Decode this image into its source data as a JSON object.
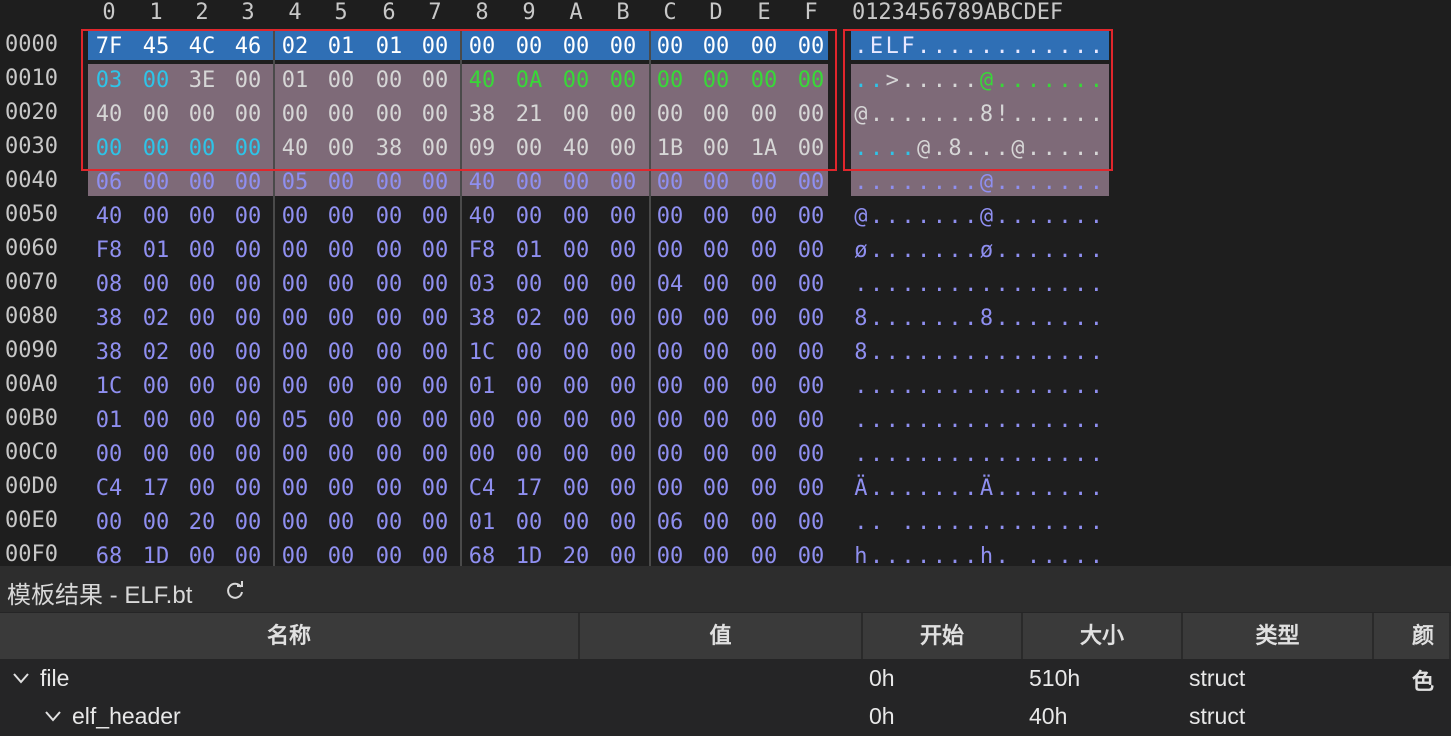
{
  "hex_header": {
    "columns": [
      "0",
      "1",
      "2",
      "3",
      "4",
      "5",
      "6",
      "7",
      "8",
      "9",
      "A",
      "B",
      "C",
      "D",
      "E",
      "F"
    ],
    "ascii": "0123456789ABCDEF"
  },
  "rows": [
    {
      "addr": "0000",
      "bytes": [
        "7F",
        "45",
        "4C",
        "46",
        "02",
        "01",
        "01",
        "00",
        "00",
        "00",
        "00",
        "00",
        "00",
        "00",
        "00",
        "00"
      ],
      "ascii": ".ELF............"
    },
    {
      "addr": "0010",
      "bytes": [
        "03",
        "00",
        "3E",
        "00",
        "01",
        "00",
        "00",
        "00",
        "40",
        "0A",
        "00",
        "00",
        "00",
        "00",
        "00",
        "00"
      ],
      "ascii": "..>.....@......."
    },
    {
      "addr": "0020",
      "bytes": [
        "40",
        "00",
        "00",
        "00",
        "00",
        "00",
        "00",
        "00",
        "38",
        "21",
        "00",
        "00",
        "00",
        "00",
        "00",
        "00"
      ],
      "ascii": "@.......8!......"
    },
    {
      "addr": "0030",
      "bytes": [
        "00",
        "00",
        "00",
        "00",
        "40",
        "00",
        "38",
        "00",
        "09",
        "00",
        "40",
        "00",
        "1B",
        "00",
        "1A",
        "00"
      ],
      "ascii": "....@.8...@....."
    },
    {
      "addr": "0040",
      "bytes": [
        "06",
        "00",
        "00",
        "00",
        "05",
        "00",
        "00",
        "00",
        "40",
        "00",
        "00",
        "00",
        "00",
        "00",
        "00",
        "00"
      ],
      "ascii": "........@......."
    },
    {
      "addr": "0050",
      "bytes": [
        "40",
        "00",
        "00",
        "00",
        "00",
        "00",
        "00",
        "00",
        "40",
        "00",
        "00",
        "00",
        "00",
        "00",
        "00",
        "00"
      ],
      "ascii": "@.......@......."
    },
    {
      "addr": "0060",
      "bytes": [
        "F8",
        "01",
        "00",
        "00",
        "00",
        "00",
        "00",
        "00",
        "F8",
        "01",
        "00",
        "00",
        "00",
        "00",
        "00",
        "00"
      ],
      "ascii": "ø.......ø......."
    },
    {
      "addr": "0070",
      "bytes": [
        "08",
        "00",
        "00",
        "00",
        "00",
        "00",
        "00",
        "00",
        "03",
        "00",
        "00",
        "00",
        "04",
        "00",
        "00",
        "00"
      ],
      "ascii": "................"
    },
    {
      "addr": "0080",
      "bytes": [
        "38",
        "02",
        "00",
        "00",
        "00",
        "00",
        "00",
        "00",
        "38",
        "02",
        "00",
        "00",
        "00",
        "00",
        "00",
        "00"
      ],
      "ascii": "8.......8......."
    },
    {
      "addr": "0090",
      "bytes": [
        "38",
        "02",
        "00",
        "00",
        "00",
        "00",
        "00",
        "00",
        "1C",
        "00",
        "00",
        "00",
        "00",
        "00",
        "00",
        "00"
      ],
      "ascii": "8..............."
    },
    {
      "addr": "00A0",
      "bytes": [
        "1C",
        "00",
        "00",
        "00",
        "00",
        "00",
        "00",
        "00",
        "01",
        "00",
        "00",
        "00",
        "00",
        "00",
        "00",
        "00"
      ],
      "ascii": "................"
    },
    {
      "addr": "00B0",
      "bytes": [
        "01",
        "00",
        "00",
        "00",
        "05",
        "00",
        "00",
        "00",
        "00",
        "00",
        "00",
        "00",
        "00",
        "00",
        "00",
        "00"
      ],
      "ascii": "................"
    },
    {
      "addr": "00C0",
      "bytes": [
        "00",
        "00",
        "00",
        "00",
        "00",
        "00",
        "00",
        "00",
        "00",
        "00",
        "00",
        "00",
        "00",
        "00",
        "00",
        "00"
      ],
      "ascii": "................"
    },
    {
      "addr": "00D0",
      "bytes": [
        "C4",
        "17",
        "00",
        "00",
        "00",
        "00",
        "00",
        "00",
        "C4",
        "17",
        "00",
        "00",
        "00",
        "00",
        "00",
        "00"
      ],
      "ascii": "Ä.......Ä......."
    },
    {
      "addr": "00E0",
      "bytes": [
        "00",
        "00",
        "20",
        "00",
        "00",
        "00",
        "00",
        "00",
        "01",
        "00",
        "00",
        "00",
        "06",
        "00",
        "00",
        "00"
      ],
      "ascii": ".. ............."
    },
    {
      "addr": "00F0",
      "bytes": [
        "68",
        "1D",
        "00",
        "00",
        "00",
        "00",
        "00",
        "00",
        "68",
        "1D",
        "20",
        "00",
        "00",
        "00",
        "00",
        "00"
      ],
      "ascii": "h.......h. ....."
    }
  ],
  "colors": {
    "default_byte": "#8f8ff0",
    "selected_bg": "#2f6fb5",
    "struct_bg": "#7e6a78",
    "cyan": "#2ec4e8",
    "green": "#38d838",
    "light": "#d6d6d6",
    "red_outline": "#e0262c"
  },
  "panel": {
    "title": "模板结果 - ELF.bt",
    "refresh_icon": "refresh-icon",
    "columns": [
      "名称",
      "值",
      "开始",
      "大小",
      "类型",
      "颜色"
    ],
    "rows": [
      {
        "name": "file",
        "value": "",
        "start": "0h",
        "size": "510h",
        "type": "struct",
        "icon": "chevron-down-icon"
      },
      {
        "name": "elf_header",
        "value": "",
        "start": "0h",
        "size": "40h",
        "type": "struct",
        "icon": "chevron-down-icon"
      }
    ]
  }
}
